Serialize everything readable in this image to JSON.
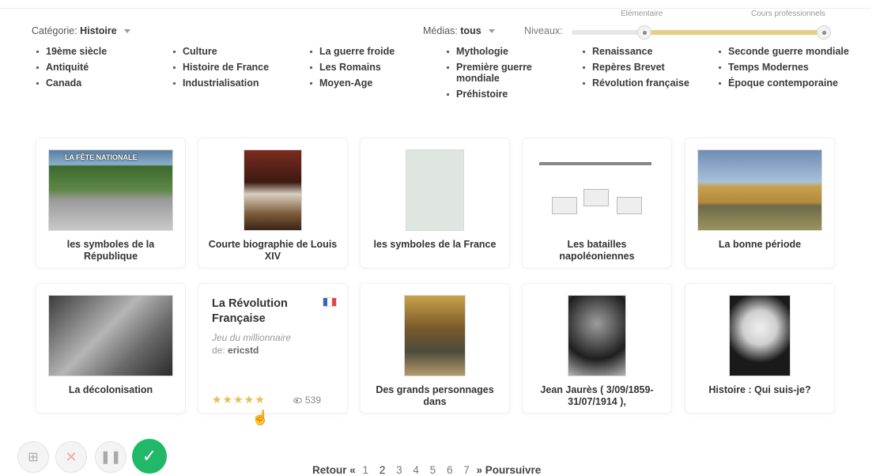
{
  "filters": {
    "category_label": "Catégorie:",
    "category_value": "Histoire",
    "media_label": "Médias:",
    "media_value": "tous",
    "levels_label": "Niveaux:",
    "level_min": "Elémentaire",
    "level_max": "Cours professionnels",
    "level_range": [
      0.28,
      1.0
    ]
  },
  "categories": [
    [
      "19ème siècle",
      "Antiquité",
      "Canada"
    ],
    [
      "Culture",
      "Histoire de France",
      "Industrialisation"
    ],
    [
      "La guerre froide",
      "Les Romains",
      "Moyen-Age"
    ],
    [
      "Mythologie",
      "Première guerre mondiale",
      "Préhistoire"
    ],
    [
      "Renaissance",
      "Repères Brevet",
      "Révolution française"
    ],
    [
      "Seconde guerre mondiale",
      "Temps Modernes",
      "Époque contemporaine"
    ]
  ],
  "cards_row1": [
    {
      "title": "les symboles de la République",
      "banner": "LA FÊTE NATIONALE"
    },
    {
      "title": "Courte biographie de Louis XIV"
    },
    {
      "title": "les symboles de la France"
    },
    {
      "title": "Les batailles napoléoniennes"
    },
    {
      "title": "La bonne période"
    }
  ],
  "cards_row2": [
    {
      "title": "La décolonisation"
    },
    {
      "title": "Des grands personnages dans"
    },
    {
      "title": "Jean Jaurès ( 3/09/1859-31/07/1914 ),"
    },
    {
      "title": "Histoire : Qui suis-je?"
    }
  ],
  "featured": {
    "title": "La Révolution Française",
    "subtitle": "Jeu du millionnaire",
    "author_label": "de:",
    "author": "ericstd",
    "stars": "★★★★★",
    "views": "539"
  },
  "pagination": {
    "prev": "Retour «",
    "pages": [
      "1",
      "2",
      "3",
      "4",
      "5",
      "6",
      "7"
    ],
    "next": "» Poursuivre"
  }
}
